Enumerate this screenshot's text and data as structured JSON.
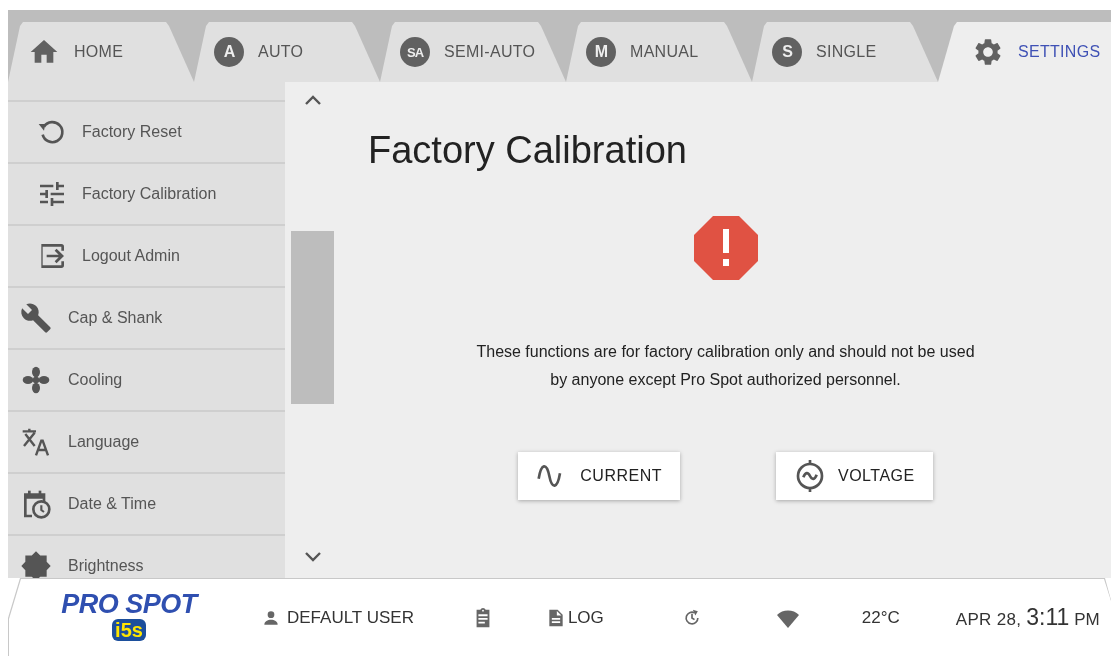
{
  "tabs": [
    {
      "label": "HOME",
      "kind": "icon",
      "selected": false
    },
    {
      "label": "AUTO",
      "kind": "badge",
      "badge": "A",
      "selected": false
    },
    {
      "label": "SEMI-AUTO",
      "kind": "badge",
      "badge": "SA",
      "selected": false
    },
    {
      "label": "MANUAL",
      "kind": "badge",
      "badge": "M",
      "selected": false
    },
    {
      "label": "SINGLE",
      "kind": "badge",
      "badge": "S",
      "selected": false
    },
    {
      "label": "SETTINGS",
      "kind": "icon",
      "selected": true
    }
  ],
  "sidebar": {
    "items": [
      {
        "label": "Factory Reset",
        "kind": "sub"
      },
      {
        "label": "Factory Calibration",
        "kind": "sub"
      },
      {
        "label": "Logout Admin",
        "kind": "sub"
      },
      {
        "label": "Cap & Shank",
        "kind": "main"
      },
      {
        "label": "Cooling",
        "kind": "main"
      },
      {
        "label": "Language",
        "kind": "main"
      },
      {
        "label": "Date & Time",
        "kind": "main"
      },
      {
        "label": "Brightness",
        "kind": "main"
      }
    ]
  },
  "main": {
    "title": "Factory Calibration",
    "message": "These functions are for factory calibration only and should not be used by anyone except Pro Spot authorized personnel.",
    "buttons": [
      {
        "label": "CURRENT"
      },
      {
        "label": "VOLTAGE"
      }
    ]
  },
  "status_bar": {
    "logo": {
      "brand": "PRO SPOT",
      "model": "i5s"
    },
    "user": "DEFAULT USER",
    "log": "LOG",
    "temperature": "22°C",
    "date": "APR 28,",
    "time": "3:11",
    "period": "PM"
  }
}
